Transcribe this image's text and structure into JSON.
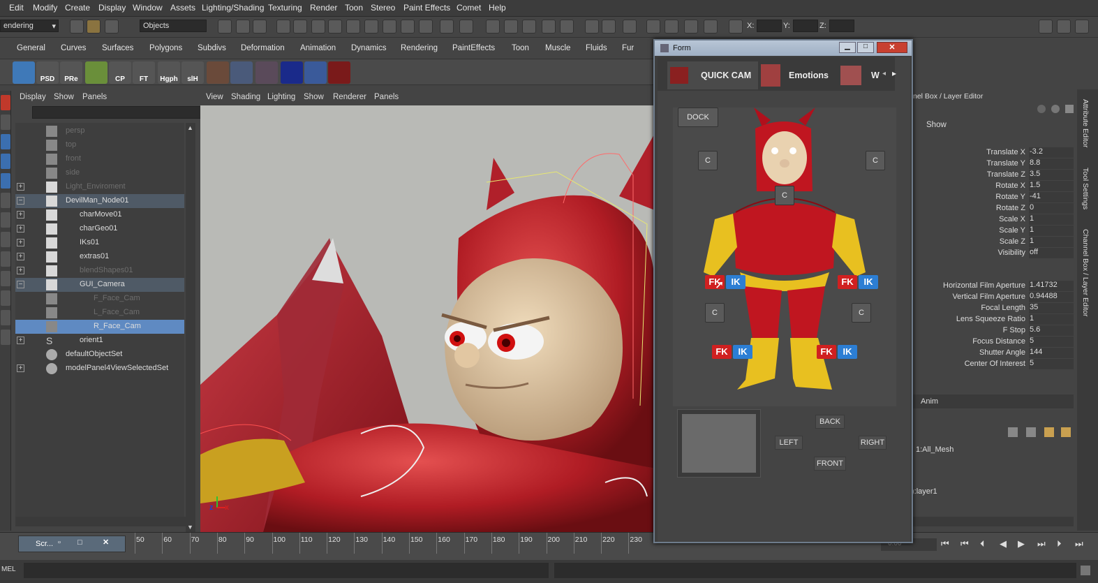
{
  "menubar": [
    "Edit",
    "Modify",
    "Create",
    "Display",
    "Window",
    "Assets",
    "Lighting/Shading",
    "Texturing",
    "Render",
    "Toon",
    "Stereo",
    "Paint Effects",
    "Comet",
    "Help"
  ],
  "status": {
    "mode": "endering",
    "selection_mask": "Objects",
    "x_label": "X:",
    "y_label": "Y:",
    "z_label": "Z:"
  },
  "shelf_tabs": [
    "General",
    "Curves",
    "Surfaces",
    "Polygons",
    "Subdivs",
    "Deformation",
    "Animation",
    "Dynamics",
    "Rendering",
    "PaintEffects",
    "Toon",
    "Muscle",
    "Fluids",
    "Fur"
  ],
  "shelf_icons": [
    "PSD",
    "PRe",
    "",
    "CP",
    "FT",
    "Hgph",
    "slH",
    "",
    "",
    "",
    "",
    ""
  ],
  "outliner": {
    "menu": [
      "Display",
      "Show",
      "Panels"
    ],
    "rows": [
      {
        "label": "persp"
      },
      {
        "label": "top"
      },
      {
        "label": "front"
      },
      {
        "label": "side"
      },
      {
        "label": "Light_Enviroment"
      },
      {
        "label": "DevilMan_Node01"
      },
      {
        "label": "charMove01"
      },
      {
        "label": "charGeo01"
      },
      {
        "label": "IKs01"
      },
      {
        "label": "extras01"
      },
      {
        "label": "blendShapes01"
      },
      {
        "label": "GUI_Camera"
      },
      {
        "label": "F_Face_Cam"
      },
      {
        "label": "L_Face_Cam"
      },
      {
        "label": "R_Face_Cam"
      },
      {
        "label": "orient1"
      },
      {
        "label": "defaultObjectSet"
      },
      {
        "label": "modelPanel4ViewSelectedSet"
      }
    ]
  },
  "viewport": {
    "menu": [
      "View",
      "Shading",
      "Lighting",
      "Show",
      "Renderer",
      "Panels"
    ],
    "axis_z": "z",
    "axis_x": "x"
  },
  "right_panel": {
    "header": "nel Box / Layer Editor",
    "show": "Show",
    "channels": [
      {
        "name": "Translate X",
        "value": "-3.2"
      },
      {
        "name": "Translate Y",
        "value": "8.8"
      },
      {
        "name": "Translate Z",
        "value": "3.5"
      },
      {
        "name": "Rotate X",
        "value": "1.5"
      },
      {
        "name": "Rotate Y",
        "value": "-41"
      },
      {
        "name": "Rotate Z",
        "value": "0"
      },
      {
        "name": "Scale X",
        "value": "1"
      },
      {
        "name": "Scale Y",
        "value": "1"
      },
      {
        "name": "Scale Z",
        "value": "1"
      },
      {
        "name": "Visibility",
        "value": "off"
      }
    ],
    "shape_channels": [
      {
        "name": "Horizontal Film Aperture",
        "value": "1.41732"
      },
      {
        "name": "Vertical Film Aperture",
        "value": "0.94488"
      },
      {
        "name": "Focal Length",
        "value": "35"
      },
      {
        "name": "Lens Squeeze Ratio",
        "value": "1"
      },
      {
        "name": "F Stop",
        "value": "5.6"
      },
      {
        "name": "Focus Distance",
        "value": "5"
      },
      {
        "name": "Shutter Angle",
        "value": "144"
      },
      {
        "name": "Center Of Interest",
        "value": "5"
      }
    ],
    "anim_tab": "Anim",
    "layers": [
      "1:All_Mesh",
      "):layer1"
    ],
    "side_tabs": [
      "Attribute Editor",
      "Tool Settings",
      "Channel Box / Layer Editor"
    ]
  },
  "timeline": {
    "ticks": [
      "50",
      "60",
      "70",
      "80",
      "90",
      "100",
      "110",
      "120",
      "130",
      "140",
      "150",
      "160",
      "170",
      "180",
      "190",
      "200",
      "210",
      "220",
      "230"
    ],
    "current": "0.00",
    "script_tab": "Scr..."
  },
  "cmdline": {
    "label": "MEL"
  },
  "form": {
    "title": "Form",
    "tabs": [
      "QUICK CAM",
      "Emotions",
      "W"
    ],
    "dock": "DOCK",
    "c_label": "C",
    "fk": "FK",
    "ik": "IK",
    "nav": {
      "back": "BACK",
      "left": "LEFT",
      "right": "RIGHT",
      "front": "FRONT"
    }
  },
  "colors": {
    "fk": "#d02020",
    "ik": "#2c7ed4",
    "selection": "#5f8ac2",
    "devil_red": "#c0202a",
    "glove_yellow": "#e8c020"
  }
}
